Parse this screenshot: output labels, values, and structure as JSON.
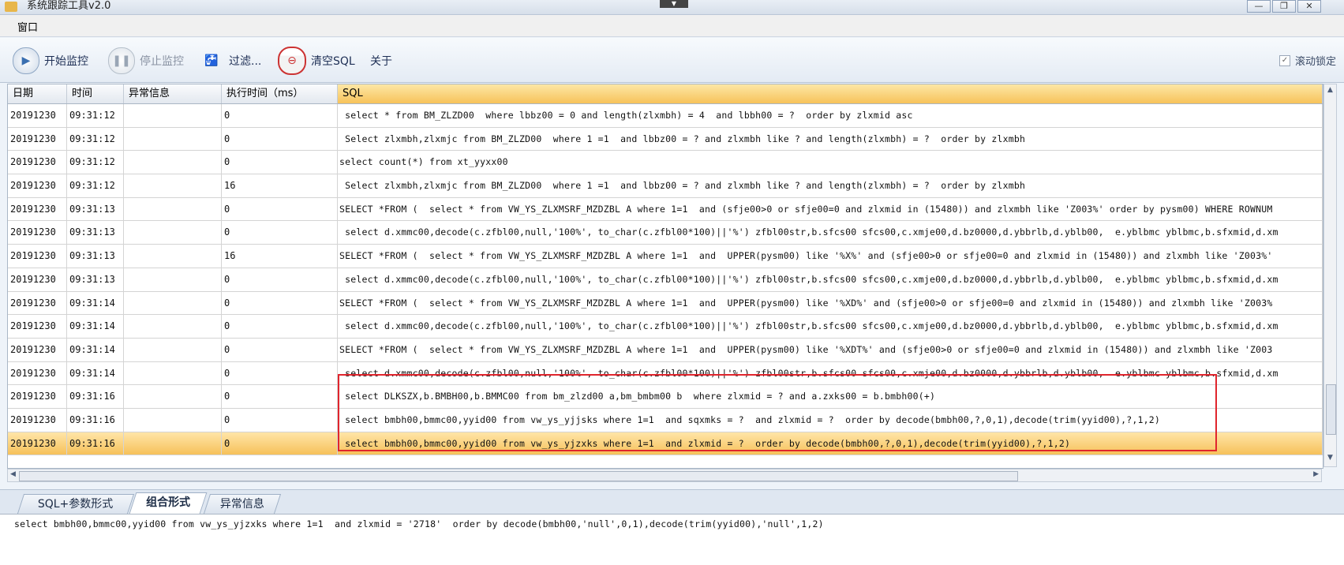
{
  "window": {
    "title": "系统跟踪工具v2.0",
    "buttons": [
      "—",
      "❐",
      "✕"
    ]
  },
  "menu": {
    "items": [
      "窗口"
    ]
  },
  "toolbar": {
    "start": "开始监控",
    "stop": "停止监控",
    "filter": "过滤...",
    "clear": "清空SQL",
    "about": "关于",
    "scroll_lock": "滚动锁定",
    "scroll_lock_checked": true
  },
  "table": {
    "headers": [
      "日期",
      "时间",
      "异常信息",
      "执行时间（ms）",
      "SQL"
    ],
    "rows": [
      {
        "date": "20191230",
        "time": "09:31:12",
        "err": "",
        "ms": "0",
        "sql": " select * from BM_ZLZD00  where lbbz00 = 0 and length(zlxmbh) = 4  and lbbh00 = ?  order by zlxmid asc"
      },
      {
        "date": "20191230",
        "time": "09:31:12",
        "err": "",
        "ms": "0",
        "sql": " Select zlxmbh,zlxmjc from BM_ZLZD00  where 1 =1  and lbbz00 = ? and zlxmbh like ? and length(zlxmbh) = ?  order by zlxmbh"
      },
      {
        "date": "20191230",
        "time": "09:31:12",
        "err": "",
        "ms": "0",
        "sql": "select count(*) from xt_yyxx00"
      },
      {
        "date": "20191230",
        "time": "09:31:12",
        "err": "",
        "ms": "16",
        "sql": " Select zlxmbh,zlxmjc from BM_ZLZD00  where 1 =1  and lbbz00 = ? and zlxmbh like ? and length(zlxmbh) = ?  order by zlxmbh"
      },
      {
        "date": "20191230",
        "time": "09:31:13",
        "err": "",
        "ms": "0",
        "sql": "SELECT *FROM (  select * from VW_YS_ZLXMSRF_MZDZBL A where 1=1  and (sfje00>0 or sfje00=0 and zlxmid in (15480)) and zlxmbh like 'Z003%' order by pysm00) WHERE ROWNUM"
      },
      {
        "date": "20191230",
        "time": "09:31:13",
        "err": "",
        "ms": "0",
        "sql": " select d.xmmc00,decode(c.zfbl00,null,'100%', to_char(c.zfbl00*100)||'%') zfbl00str,b.sfcs00 sfcs00,c.xmje00,d.bz0000,d.ybbrlb,d.yblb00,  e.yblbmc yblbmc,b.sfxmid,d.xm"
      },
      {
        "date": "20191230",
        "time": "09:31:13",
        "err": "",
        "ms": "16",
        "sql": "SELECT *FROM (  select * from VW_YS_ZLXMSRF_MZDZBL A where 1=1  and  UPPER(pysm00) like '%X%' and (sfje00>0 or sfje00=0 and zlxmid in (15480)) and zlxmbh like 'Z003%'"
      },
      {
        "date": "20191230",
        "time": "09:31:13",
        "err": "",
        "ms": "0",
        "sql": " select d.xmmc00,decode(c.zfbl00,null,'100%', to_char(c.zfbl00*100)||'%') zfbl00str,b.sfcs00 sfcs00,c.xmje00,d.bz0000,d.ybbrlb,d.yblb00,  e.yblbmc yblbmc,b.sfxmid,d.xm"
      },
      {
        "date": "20191230",
        "time": "09:31:14",
        "err": "",
        "ms": "0",
        "sql": "SELECT *FROM (  select * from VW_YS_ZLXMSRF_MZDZBL A where 1=1  and  UPPER(pysm00) like '%XD%' and (sfje00>0 or sfje00=0 and zlxmid in (15480)) and zlxmbh like 'Z003%"
      },
      {
        "date": "20191230",
        "time": "09:31:14",
        "err": "",
        "ms": "0",
        "sql": " select d.xmmc00,decode(c.zfbl00,null,'100%', to_char(c.zfbl00*100)||'%') zfbl00str,b.sfcs00 sfcs00,c.xmje00,d.bz0000,d.ybbrlb,d.yblb00,  e.yblbmc yblbmc,b.sfxmid,d.xm"
      },
      {
        "date": "20191230",
        "time": "09:31:14",
        "err": "",
        "ms": "0",
        "sql": "SELECT *FROM (  select * from VW_YS_ZLXMSRF_MZDZBL A where 1=1  and  UPPER(pysm00) like '%XDT%' and (sfje00>0 or sfje00=0 and zlxmid in (15480)) and zlxmbh like 'Z003"
      },
      {
        "date": "20191230",
        "time": "09:31:14",
        "err": "",
        "ms": "0",
        "sql": " select d.xmmc00,decode(c.zfbl00,null,'100%', to_char(c.zfbl00*100)||'%') zfbl00str,b.sfcs00 sfcs00,c.xmje00,d.bz0000,d.ybbrlb,d.yblb00,  e.yblbmc yblbmc,b.sfxmid,d.xm"
      },
      {
        "date": "20191230",
        "time": "09:31:16",
        "err": "",
        "ms": "0",
        "sql": " select DLKSZX,b.BMBH00,b.BMMC00 from bm_zlzd00 a,bm_bmbm00 b  where zlxmid = ? and a.zxks00 = b.bmbh00(+)"
      },
      {
        "date": "20191230",
        "time": "09:31:16",
        "err": "",
        "ms": "0",
        "sql": " select bmbh00,bmmc00,yyid00 from vw_ys_yjjsks where 1=1  and sqxmks = ?  and zlxmid = ?  order by decode(bmbh00,?,0,1),decode(trim(yyid00),?,1,2)"
      },
      {
        "date": "20191230",
        "time": "09:31:16",
        "err": "",
        "ms": "0",
        "sql": " select bmbh00,bmmc00,yyid00 from vw_ys_yjzxks where 1=1  and zlxmid = ?  order by decode(bmbh00,?,0,1),decode(trim(yyid00),?,1,2)",
        "selected": true
      }
    ]
  },
  "bottom": {
    "tabs": [
      "SQL+参数形式",
      "组合形式",
      "异常信息"
    ],
    "active_tab": "组合形式",
    "detail_sql": "select bmbh00,bmmc00,yyid00 from vw_ys_yjzxks where 1=1  and zlxmid = '2718'  order by decode(bmbh00,'null',0,1),decode(trim(yyid00),'null',1,2)"
  },
  "colors": {
    "highlight": "#f6c15a",
    "annotation": "#e0252d",
    "toolbar_text": "#1e2f55"
  }
}
